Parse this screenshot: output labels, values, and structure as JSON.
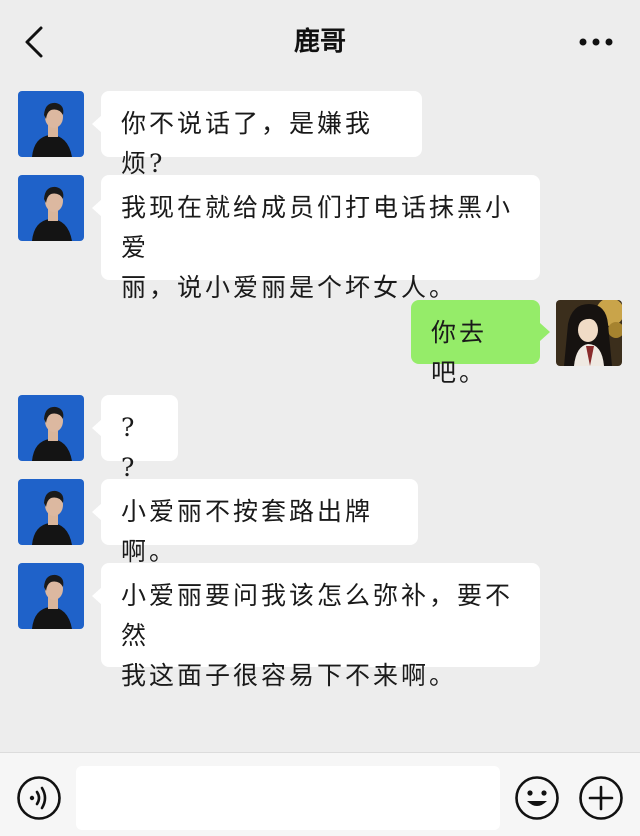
{
  "header": {
    "title": "鹿哥",
    "back_icon": "chevron-left-icon",
    "more_icon": "more-horizontal-icon"
  },
  "messages": [
    {
      "side": "left",
      "lines": [
        "你不说话了，是嫌我烦?"
      ]
    },
    {
      "side": "left",
      "lines": [
        "我现在就给成员们打电话抹黑小爱",
        "丽，说小爱丽是个坏女人。"
      ]
    },
    {
      "side": "right",
      "lines": [
        "你去吧。"
      ]
    },
    {
      "side": "left",
      "lines": [
        "? ?"
      ]
    },
    {
      "side": "left",
      "lines": [
        "小爱丽不按套路出牌啊。"
      ]
    },
    {
      "side": "left",
      "lines": [
        "小爱丽要问我该怎么弥补，要不然",
        "我这面子很容易下不来啊。"
      ]
    }
  ],
  "input_bar": {
    "voice_icon": "voice-icon",
    "input_value": "",
    "emoji_icon": "emoji-icon",
    "plus_icon": "plus-circle-icon"
  },
  "colors": {
    "background": "#ededed",
    "bubble_left": "#ffffff",
    "bubble_right": "#95ec69",
    "left_avatar_bg": "#1f62c9"
  }
}
